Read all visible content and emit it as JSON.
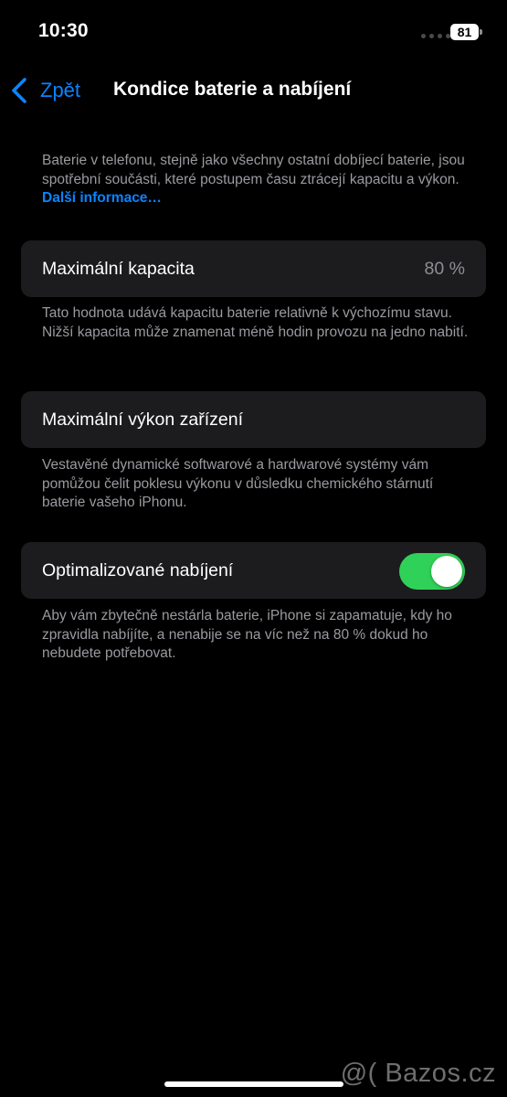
{
  "status_bar": {
    "time": "10:30",
    "battery_level": "81"
  },
  "nav": {
    "back_label": "Zpět",
    "title": "Kondice baterie a nabíjení"
  },
  "intro": {
    "text": "Baterie v telefonu, stejně jako všechny ostatní dobíjecí baterie, jsou spotřební součásti, které postupem času ztrácejí kapacitu a výkon.",
    "link": "Další informace…"
  },
  "max_capacity": {
    "label": "Maximální kapacita",
    "value": "80 %",
    "footnote": "Tato hodnota udává kapacitu baterie relativně k výchozímu stavu. Nižší kapacita může znamenat méně hodin provozu na jedno nabití."
  },
  "peak_performance": {
    "label": "Maximální výkon zařízení",
    "footnote": "Vestavěné dynamické softwarové a hardwarové systémy vám pomůžou čelit poklesu výkonu v důsledku chemického stárnutí baterie vašeho iPhonu."
  },
  "optimized_charging": {
    "label": "Optimalizované nabíjení",
    "enabled": true,
    "footnote": "Aby vám zbytečně nestárla baterie, iPhone si zapamatuje, kdy ho zpravidla nabíjíte, a nenabije se na víc než na 80 % dokud ho nebudete potřebovat."
  },
  "watermark": "@( Bazos.cz",
  "colors": {
    "background": "#000000",
    "cell": "#1c1c1e",
    "accent": "#0a84ff",
    "toggle_on": "#30d158",
    "secondary_text": "#9a9aa0"
  }
}
